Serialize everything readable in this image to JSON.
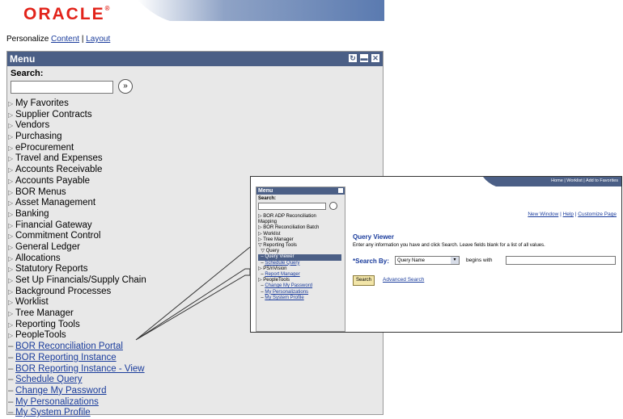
{
  "logo": {
    "text": "ORACLE",
    "mark": "®"
  },
  "personalize": {
    "prefix": "Personalize",
    "content": "Content",
    "separator": "|",
    "layout": "Layout"
  },
  "menu": {
    "title": "Menu",
    "search_label": "Search:",
    "search_value": "",
    "items": [
      {
        "label": "My Favorites",
        "type": "folder"
      },
      {
        "label": "Supplier Contracts",
        "type": "folder"
      },
      {
        "label": "Vendors",
        "type": "folder"
      },
      {
        "label": "Purchasing",
        "type": "folder"
      },
      {
        "label": "eProcurement",
        "type": "folder"
      },
      {
        "label": "Travel and Expenses",
        "type": "folder"
      },
      {
        "label": "Accounts Receivable",
        "type": "folder"
      },
      {
        "label": "Accounts Payable",
        "type": "folder"
      },
      {
        "label": "BOR Menus",
        "type": "folder"
      },
      {
        "label": "Asset Management",
        "type": "folder"
      },
      {
        "label": "Banking",
        "type": "folder"
      },
      {
        "label": "Financial Gateway",
        "type": "folder"
      },
      {
        "label": "Commitment Control",
        "type": "folder"
      },
      {
        "label": "General Ledger",
        "type": "folder"
      },
      {
        "label": "Allocations",
        "type": "folder"
      },
      {
        "label": "Statutory Reports",
        "type": "folder"
      },
      {
        "label": "Set Up Financials/Supply Chain",
        "type": "folder"
      },
      {
        "label": "Background Processes",
        "type": "folder"
      },
      {
        "label": "Worklist",
        "type": "folder"
      },
      {
        "label": "Tree Manager",
        "type": "folder"
      },
      {
        "label": "Reporting Tools",
        "type": "folder"
      },
      {
        "label": "PeopleTools",
        "type": "folder"
      },
      {
        "label": "BOR Reconciliation Portal",
        "type": "link"
      },
      {
        "label": "BOR Reporting Instance",
        "type": "link"
      },
      {
        "label": "BOR Reporting Instance - View",
        "type": "link"
      },
      {
        "label": "Schedule Query",
        "type": "link"
      },
      {
        "label": "Change My Password",
        "type": "link"
      },
      {
        "label": "My Personalizations",
        "type": "link"
      },
      {
        "label": "My System Profile",
        "type": "link"
      }
    ]
  },
  "inset": {
    "menu_title": "Menu",
    "search_label": "Search:",
    "items": [
      {
        "label": "BOR ADP Reconciliation",
        "style": "folder"
      },
      {
        "label": "Mapping",
        "style": "plain"
      },
      {
        "label": "BOR Reconciliation Batch",
        "style": "folder"
      },
      {
        "label": "Worklist",
        "style": "folder"
      },
      {
        "label": "Tree Manager",
        "style": "folder"
      },
      {
        "label": "Reporting Tools",
        "style": "open"
      },
      {
        "label": "Query",
        "style": "open"
      },
      {
        "label": "Query Viewer",
        "style": "selected"
      },
      {
        "label": "Schedule Query",
        "style": "link"
      },
      {
        "label": "PS/nVision",
        "style": "folder"
      },
      {
        "label": "Report Manager",
        "style": "link"
      },
      {
        "label": "PeopleTools",
        "style": "folder"
      },
      {
        "label": "Change My Password",
        "style": "link"
      },
      {
        "label": "My Personalizations",
        "style": "link"
      },
      {
        "label": "My System Profile",
        "style": "link"
      }
    ],
    "top_links": [
      "Home",
      "Worklist",
      "Add to Favorites"
    ],
    "window_links": [
      "New Window",
      "Help",
      "Customize Page"
    ],
    "query_viewer": {
      "title": "Query Viewer",
      "description": "Enter any information you have and click Search. Leave fields blank for a list of all values.",
      "search_by_label": "*Search By:",
      "search_by_value": "Query Name",
      "begins_with": "begins with",
      "search_button": "Search",
      "advanced_search": "Advanced Search"
    }
  },
  "colors": {
    "brand": "#e2231a",
    "menu_header": "#4b5f86",
    "link": "#1a3c9c"
  }
}
